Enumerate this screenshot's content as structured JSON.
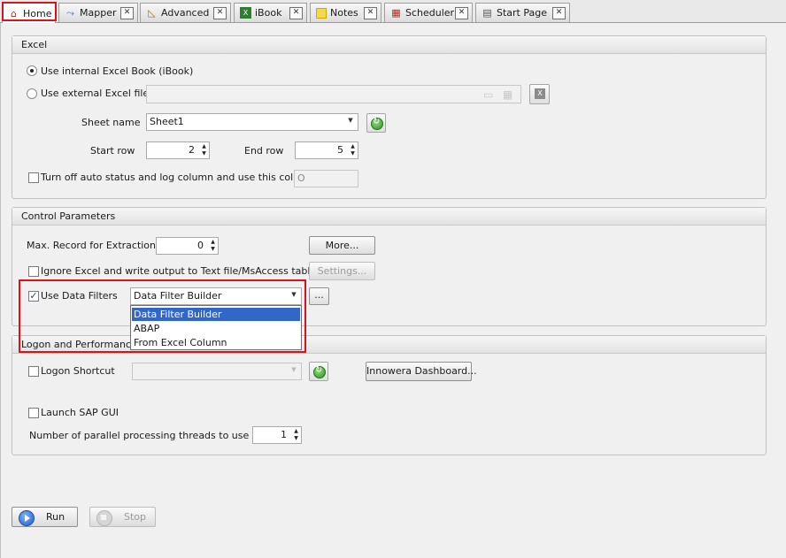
{
  "tabs": [
    {
      "label": "Home",
      "icon": "house-icon",
      "active": true
    },
    {
      "label": "Mapper",
      "icon": "mapper-icon"
    },
    {
      "label": "Advanced",
      "icon": "ruler-icon"
    },
    {
      "label": "iBook",
      "icon": "excel-book-icon"
    },
    {
      "label": "Notes",
      "icon": "note-icon"
    },
    {
      "label": "Scheduler",
      "icon": "calendar-icon"
    },
    {
      "label": "Start Page",
      "icon": "start-page-icon"
    }
  ],
  "excel": {
    "title": "Excel",
    "internal_label": "Use internal Excel Book (iBook)",
    "external_label": "Use external Excel file",
    "external_value": "",
    "sheet_label": "Sheet name",
    "sheet_value": "Sheet1",
    "start_row_label": "Start row",
    "start_row_value": "2",
    "end_row_label": "End row",
    "end_row_value": "5",
    "turn_off_label": "Turn off auto status and log column and use this column",
    "column_value": "O"
  },
  "control": {
    "title": "Control Parameters",
    "max_record_label": "Max. Record for Extraction",
    "max_record_value": "0",
    "more_label": "More...",
    "ignore_label": "Ignore Excel and write output to Text file/MsAccess table",
    "settings_label": "Settings...",
    "use_filters_label": "Use Data Filters",
    "filter_value": "Data Filter Builder",
    "ellipsis_label": "...",
    "filter_options": [
      "Data Filter Builder",
      "ABAP",
      "From Excel Column"
    ]
  },
  "logon": {
    "title": "Logon and Performance",
    "shortcut_label": "Logon Shortcut",
    "shortcut_value": "",
    "dashboard_label": "Innowera Dashboard...",
    "launch_label": "Launch SAP GUI",
    "threads_label": "Number of parallel processing threads to use",
    "threads_value": "1"
  },
  "footer": {
    "run_label": "Run",
    "stop_label": "Stop"
  },
  "colors": {
    "highlight": "#d8131b",
    "selection": "#3266c7"
  }
}
